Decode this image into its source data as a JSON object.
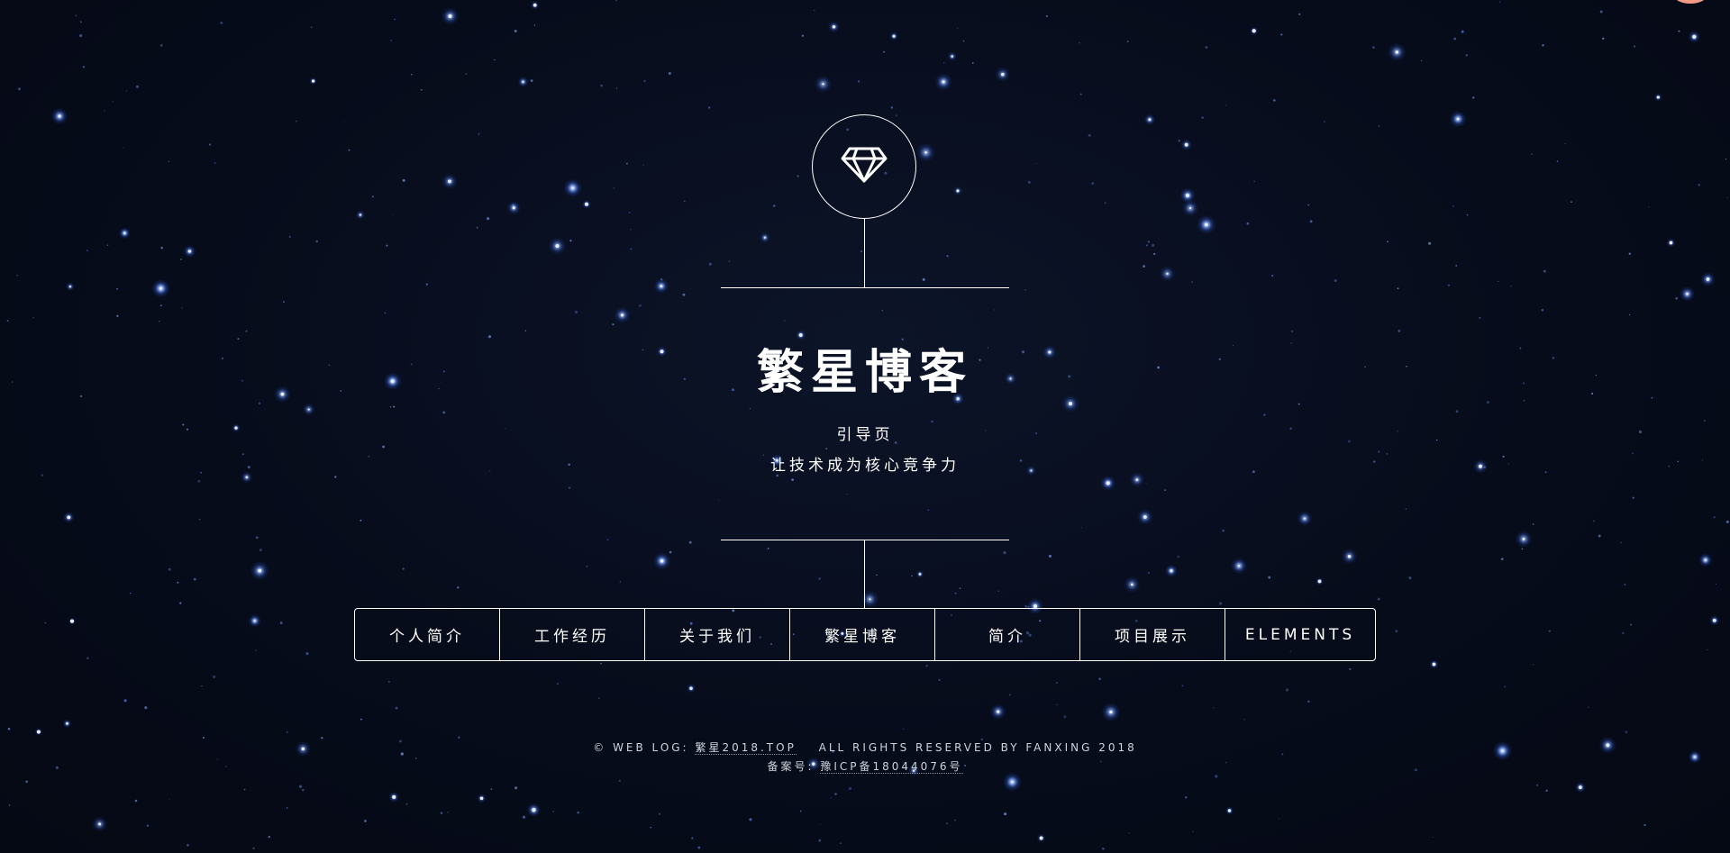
{
  "colors": {
    "background": "#070c1b",
    "foreground": "#ffffff",
    "star": "#5a8cff",
    "footer_text": "#cfd3db"
  },
  "header": {
    "logo_icon": "diamond-icon",
    "title": "繁星博客",
    "subtitle": "引导页",
    "tagline": "让技术成为核心竞争力"
  },
  "nav": {
    "items": [
      {
        "label": "个人简介"
      },
      {
        "label": "工作经历"
      },
      {
        "label": "关于我们"
      },
      {
        "label": "繁星博客"
      },
      {
        "label": "简介"
      },
      {
        "label": "项目展示"
      },
      {
        "label": "ELEMENTS"
      }
    ]
  },
  "footer": {
    "copyright_prefix": "© WEB LOG:",
    "site_link": "繁星2018.TOP",
    "rights": "ALL RIGHTS RESERVED BY FANXING 2018",
    "icp_label": "备案号:",
    "icp_link": "豫ICP备18044076号"
  }
}
